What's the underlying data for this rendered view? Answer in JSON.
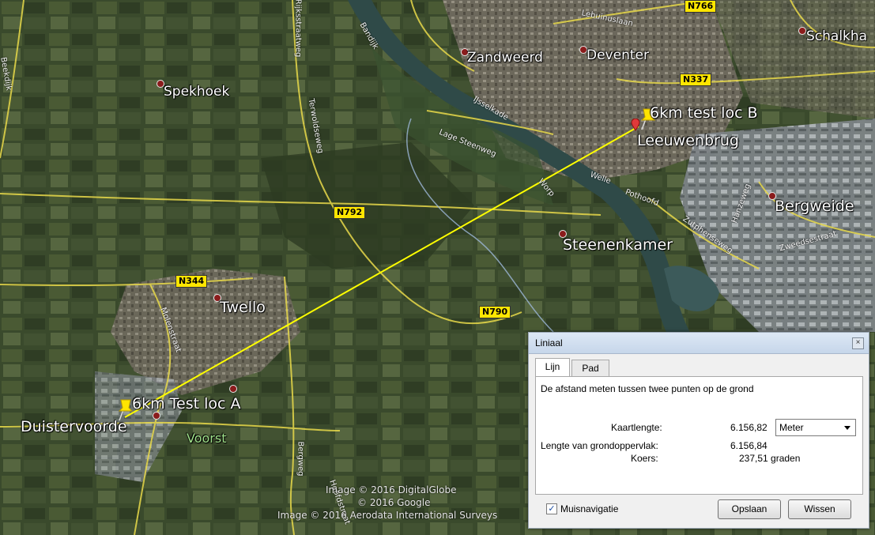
{
  "map": {
    "places": [
      {
        "key": "zandweerd",
        "label": "Zandweerd"
      },
      {
        "key": "deventer",
        "label": "Deventer"
      },
      {
        "key": "schalkhaar",
        "label": "Schalkha"
      },
      {
        "key": "spekhoek",
        "label": "Spekhoek"
      },
      {
        "key": "leeuwenbrug",
        "label": "Leeuwenbrug"
      },
      {
        "key": "bergweide",
        "label": "Bergweide"
      },
      {
        "key": "steenenkamer",
        "label": "Steenenkamer"
      },
      {
        "key": "twello",
        "label": "Twello"
      },
      {
        "key": "duistervoorde",
        "label": "Duistervoorde"
      },
      {
        "key": "voorst",
        "label": "Voorst"
      }
    ],
    "placemarks": {
      "a": "6km Test loc A",
      "b": "6km test loc B"
    },
    "shields": {
      "n766": "N766",
      "n337": "N337",
      "n792": "N792",
      "n344": "N344",
      "n790": "N790"
    },
    "roads": {
      "lebuinuslaan": "Lebuinuslaan",
      "ijsselkade": "IJsselkade",
      "lage_steenweg": "Lage Steenweg",
      "worp": "Worp",
      "welle": "Welle",
      "pothoofd": "Pothoofd",
      "zutphenseweg": "Zutphenseweg",
      "hanzeweg": "Hanzeweg",
      "zweedsestraat": "Zweedsestraat",
      "bandijk": "Bandijk",
      "terwoldseweg": "Terwoldseweg",
      "molenstraat": "Molenstraat",
      "bergweg": "Bergweg",
      "beekdijk": "Beekdijk",
      "rijksstraatweg": "Rijksstraatweg",
      "hoofdstraat": "Hoofdstraat"
    },
    "copyright": [
      "Image © 2016 DigitalGlobe",
      "© 2016 Google",
      "Image © 2016 Aerodata International Surveys"
    ],
    "colors": {
      "measure_line": "#ffff00",
      "road": "#e8d94a",
      "river": "#2f4a48"
    }
  },
  "ruler": {
    "title": "Liniaal",
    "close_icon": "×",
    "tabs": [
      {
        "label": "Lijn",
        "active": true
      },
      {
        "label": "Pad",
        "active": false
      }
    ],
    "description": "De afstand meten tussen twee punten op de grond",
    "map_length_label": "Kaartlengte:",
    "map_length_value": "6.156,82",
    "unit_selected": "Meter",
    "ground_length_label": "Lengte van grondoppervlak:",
    "ground_length_value": "6.156,84",
    "heading_label": "Koers:",
    "heading_value": "237,51 graden",
    "mouse_nav_label": "Muisnavigatie",
    "mouse_nav_checked": true,
    "save_label": "Opslaan",
    "clear_label": "Wissen"
  }
}
